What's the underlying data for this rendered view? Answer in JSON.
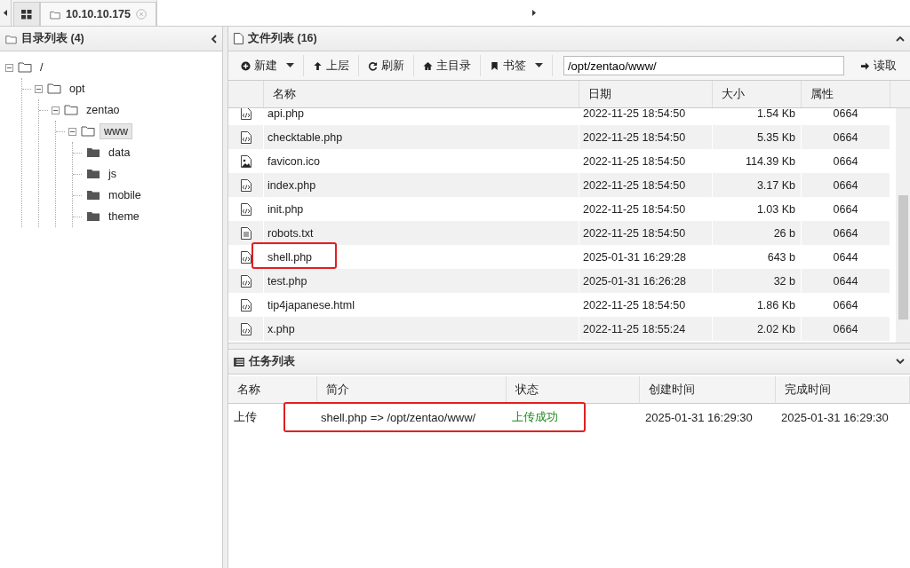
{
  "tabs": [
    {
      "kind": "apps",
      "selected": false
    },
    {
      "kind": "host",
      "label": "10.10.10.175",
      "selected": true
    }
  ],
  "directory_panel": {
    "title": "目录列表 (4)",
    "tree": [
      {
        "label": "/",
        "expanded": true,
        "selected": false,
        "children": [
          {
            "label": "opt",
            "expanded": true,
            "selected": false,
            "children": [
              {
                "label": "zentao",
                "expanded": true,
                "selected": false,
                "children": [
                  {
                    "label": "www",
                    "expanded": true,
                    "selected": true,
                    "children": [
                      {
                        "label": "data",
                        "expanded": false,
                        "selected": false
                      },
                      {
                        "label": "js",
                        "expanded": false,
                        "selected": false
                      },
                      {
                        "label": "mobile",
                        "expanded": false,
                        "selected": false
                      },
                      {
                        "label": "theme",
                        "expanded": false,
                        "selected": false
                      }
                    ]
                  }
                ]
              }
            ]
          }
        ]
      }
    ]
  },
  "file_panel": {
    "title": "文件列表 (16)",
    "toolbar": [
      {
        "kind": "new",
        "label": "新建",
        "dropdown": true
      },
      {
        "kind": "up",
        "label": "上层",
        "dropdown": false
      },
      {
        "kind": "refresh",
        "label": "刷新",
        "dropdown": false
      },
      {
        "kind": "home",
        "label": "主目录",
        "dropdown": false
      },
      {
        "kind": "bookmark",
        "label": "书签",
        "dropdown": true
      }
    ],
    "path": "/opt/zentao/www/",
    "read_button": "读取",
    "columns": [
      "名称",
      "日期",
      "大小",
      "属性"
    ],
    "rows": [
      {
        "kind": "code",
        "name": "api.php",
        "date": "2022-11-25 18:54:50",
        "size": "1.54 Kb",
        "attr": "0664",
        "highlighted": false
      },
      {
        "kind": "code",
        "name": "checktable.php",
        "date": "2022-11-25 18:54:50",
        "size": "5.35 Kb",
        "attr": "0664",
        "highlighted": false
      },
      {
        "kind": "image",
        "name": "favicon.ico",
        "date": "2022-11-25 18:54:50",
        "size": "114.39 Kb",
        "attr": "0664",
        "highlighted": false
      },
      {
        "kind": "code",
        "name": "index.php",
        "date": "2022-11-25 18:54:50",
        "size": "3.17 Kb",
        "attr": "0664",
        "highlighted": false
      },
      {
        "kind": "code",
        "name": "init.php",
        "date": "2022-11-25 18:54:50",
        "size": "1.03 Kb",
        "attr": "0664",
        "highlighted": false
      },
      {
        "kind": "text",
        "name": "robots.txt",
        "date": "2022-11-25 18:54:50",
        "size": "26 b",
        "attr": "0664",
        "highlighted": false
      },
      {
        "kind": "code",
        "name": "shell.php",
        "date": "2025-01-31 16:29:28",
        "size": "643 b",
        "attr": "0644",
        "highlighted": true
      },
      {
        "kind": "code",
        "name": "test.php",
        "date": "2025-01-31 16:26:28",
        "size": "32 b",
        "attr": "0644",
        "highlighted": false
      },
      {
        "kind": "code",
        "name": "tip4japanese.html",
        "date": "2022-11-25 18:54:50",
        "size": "1.86 Kb",
        "attr": "0664",
        "highlighted": false
      },
      {
        "kind": "code",
        "name": "x.php",
        "date": "2022-11-25 18:55:24",
        "size": "2.02 Kb",
        "attr": "0664",
        "highlighted": false
      }
    ]
  },
  "task_panel": {
    "title": "任务列表",
    "columns": [
      "名称",
      "简介",
      "状态",
      "创建时间",
      "完成时间"
    ],
    "rows": [
      {
        "name": "上传",
        "summary": "shell.php => /opt/zentao/www/",
        "status": "上传成功",
        "created": "2025-01-31 16:29:30",
        "finished": "2025-01-31 16:29:30",
        "highlighted": true
      }
    ]
  }
}
